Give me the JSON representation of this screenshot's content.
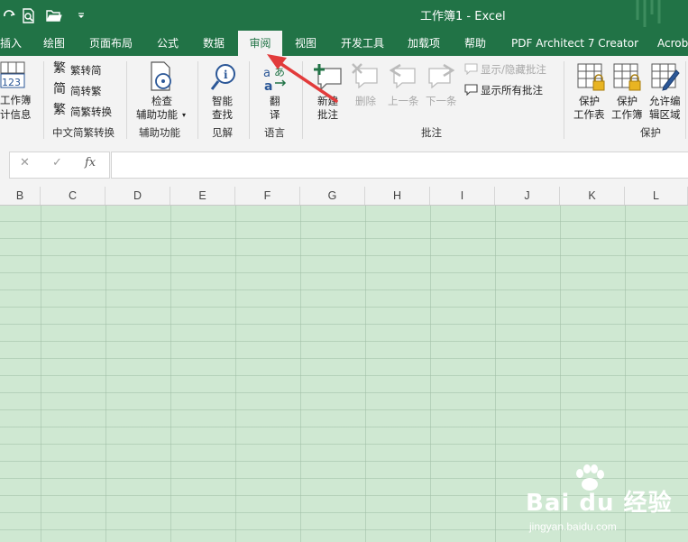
{
  "window": {
    "title": "工作簿1  -  Excel"
  },
  "quick_access": [
    "autosave-icon",
    "print-preview-icon",
    "open-folder-icon",
    "customize-qat-icon"
  ],
  "tabs": [
    {
      "label": "插入",
      "active": false
    },
    {
      "label": "绘图",
      "active": false
    },
    {
      "label": "页面布局",
      "active": false
    },
    {
      "label": "公式",
      "active": false
    },
    {
      "label": "数据",
      "active": false
    },
    {
      "label": "审阅",
      "active": true
    },
    {
      "label": "视图",
      "active": false
    },
    {
      "label": "开发工具",
      "active": false
    },
    {
      "label": "加载项",
      "active": false
    },
    {
      "label": "帮助",
      "active": false
    },
    {
      "label": "PDF Architect 7 Creator",
      "active": false
    },
    {
      "label": "Acrob",
      "active": false
    }
  ],
  "ribbon": {
    "proofing": {
      "workbook_stats_line1": "工作簿",
      "workbook_stats_line2": "计信息",
      "icon_text": "123"
    },
    "chinese_conversion": {
      "label": "中文简繁转换",
      "to_simplified": "繁转简",
      "to_traditional": "简转繁",
      "convert": "简繁转换"
    },
    "accessibility": {
      "label": "辅助功能",
      "check_line1": "检查",
      "check_line2": "辅助功能"
    },
    "insights": {
      "label": "见解",
      "smart_lookup_line1": "智能",
      "smart_lookup_line2": "查找"
    },
    "language": {
      "label": "语言",
      "translate_line1": "翻",
      "translate_line2": "译"
    },
    "comments": {
      "label": "批注",
      "new_line1": "新建",
      "new_line2": "批注",
      "delete": "删除",
      "previous": "上一条",
      "next": "下一条",
      "show_hide": "显示/隐藏批注",
      "show_all": "显示所有批注"
    },
    "protect": {
      "label": "保护",
      "sheet_line1": "保护",
      "sheet_line2": "工作表",
      "workbook_line1": "保护",
      "workbook_line2": "工作簿",
      "allow_edit_line1": "允许编",
      "allow_edit_line2": "辑区域"
    }
  },
  "formula_bar": {
    "cancel": "✕",
    "enter": "✓",
    "fx": "fx",
    "value": ""
  },
  "columns": [
    "B",
    "C",
    "D",
    "E",
    "F",
    "G",
    "H",
    "I",
    "J",
    "K",
    "L"
  ],
  "watermark": {
    "brand": "Bai du 经验",
    "url": "jingyan.baidu.com"
  },
  "colors": {
    "accent": "#217346",
    "ribbon_bg": "#f3f3f3",
    "grid_bg": "#cfe8d2",
    "arrow": "#e23b3b"
  }
}
